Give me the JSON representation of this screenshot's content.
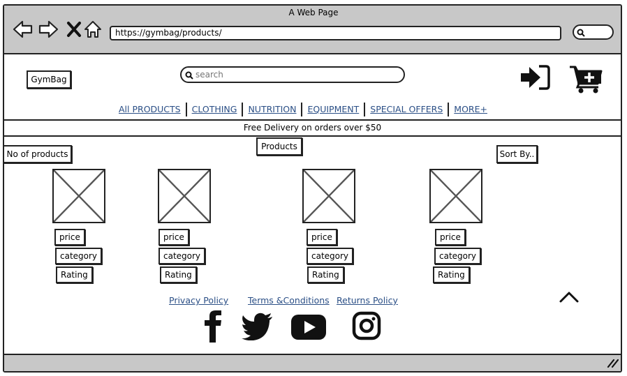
{
  "window": {
    "title": "A Web Page",
    "url": "https://gymbag/products/"
  },
  "header": {
    "logo": "GymBag",
    "search_placeholder": "search"
  },
  "menu": [
    "All PRODUCTS",
    "CLOTHING",
    "NUTRITION",
    "EQUIPMENT",
    "SPECIAL OFFERS",
    "MORE+"
  ],
  "banner": "Free Delivery on orders over $50",
  "toolbar": {
    "count_label": "No of products",
    "section_title": "Products",
    "sort_label": "Sort By.."
  },
  "products": [
    {
      "price": "price",
      "category": "category",
      "rating": "Rating"
    },
    {
      "price": "price",
      "category": "category",
      "rating": "Rating"
    },
    {
      "price": "price",
      "category": "category",
      "rating": "Rating"
    },
    {
      "price": "price",
      "category": "category",
      "rating": "Rating"
    }
  ],
  "footer": {
    "links": [
      "Privacy Policy",
      "Terms &Conditions",
      "Returns Policy"
    ]
  },
  "icons": {
    "back": "arrow-left-icon",
    "forward": "arrow-right-icon",
    "stop": "close-icon",
    "home": "home-icon",
    "login": "sign-in-icon",
    "cart": "cart-plus-icon",
    "top": "chevron-up-icon",
    "facebook": "facebook-icon",
    "twitter": "twitter-icon",
    "youtube": "youtube-icon",
    "instagram": "instagram-icon"
  }
}
